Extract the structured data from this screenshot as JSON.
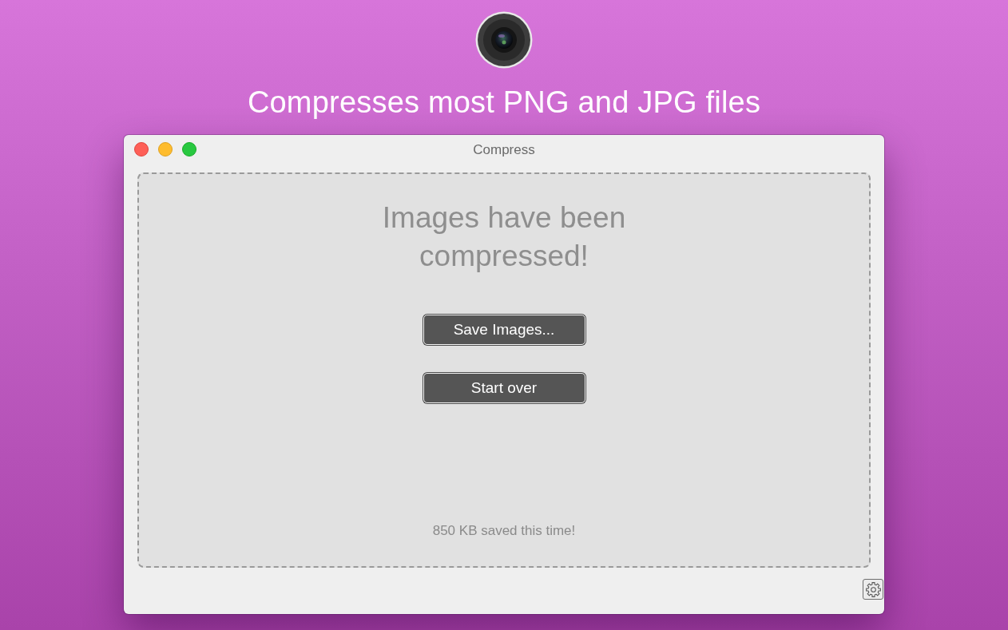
{
  "headline": "Compresses most PNG and JPG files",
  "window": {
    "title": "Compress"
  },
  "drop_zone": {
    "message": "Images have been compressed!",
    "buttons": [
      "Save Images...",
      "Start over"
    ],
    "summary": "850 KB saved this time!"
  }
}
